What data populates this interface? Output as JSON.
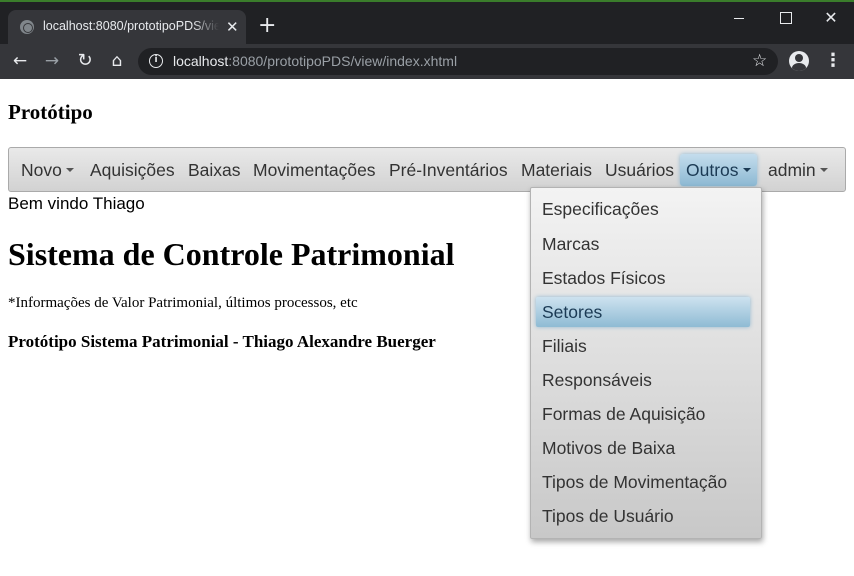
{
  "browser": {
    "tab_title": "localhost:8080/prototipoPDS/view/index.xhtml",
    "close_tab_glyph": "✕",
    "new_tab_glyph": "+",
    "url_host": "localhost",
    "url_rest": ":8080/prototipoPDS/view/index.xhtml",
    "icons": [
      "globe-icon",
      "back-icon",
      "forward-icon",
      "reload-icon",
      "home-icon",
      "info-icon",
      "star-icon",
      "profile-icon",
      "more-icon"
    ]
  },
  "page": {
    "brand": "Protótipo",
    "welcome": "Bem vindo Thiago",
    "title": "Sistema de Controle Patrimonial",
    "note": "*Informações de Valor Patrimonial, últimos processos, etc",
    "footer": "Protótipo Sistema Patrimonial - Thiago Alexandre Buerger"
  },
  "menubar": {
    "items": [
      {
        "label": "Novo",
        "has_caret": true
      },
      {
        "label": "Aquisições"
      },
      {
        "label": "Baixas"
      },
      {
        "label": "Movimentações"
      },
      {
        "label": "Pré-Inventários"
      },
      {
        "label": "Materiais"
      },
      {
        "label": "Usuários"
      },
      {
        "label": "Outros",
        "has_caret": true,
        "open": true
      },
      {
        "label": "admin",
        "has_caret": true
      }
    ],
    "active_color": "#8cb8d2"
  },
  "dropdown": {
    "items": [
      {
        "label": "Especificações"
      },
      {
        "label": "Marcas"
      },
      {
        "label": "Estados Físicos"
      },
      {
        "label": "Setores",
        "hovered": true
      },
      {
        "label": "Filiais"
      },
      {
        "label": "Responsáveis"
      },
      {
        "label": "Formas de Aquisição"
      },
      {
        "label": "Motivos de Baixa"
      },
      {
        "label": "Tipos de Movimentação"
      },
      {
        "label": "Tipos de Usuário"
      }
    ]
  }
}
